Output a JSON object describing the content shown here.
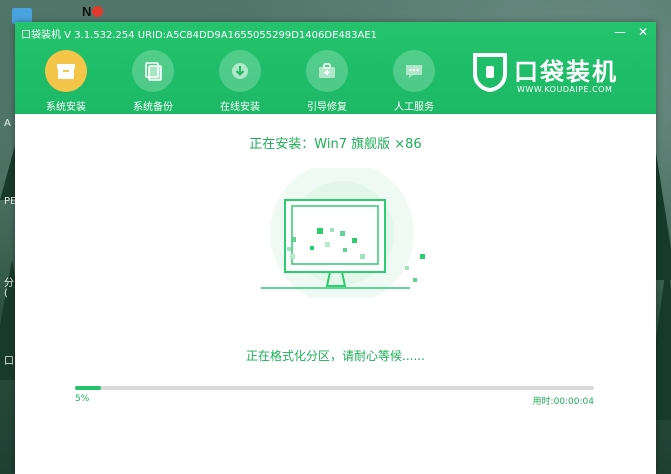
{
  "app": {
    "title": "口袋装机 V 3.1.532.254 URID:A5C84DD9A1655055299D1406DE483AE1",
    "minimize_label": "—",
    "close_label": "✕"
  },
  "desktop": {
    "badge_text": "N",
    "side_labels": [
      "A",
      "PE",
      "分",
      "(",
      "口"
    ]
  },
  "nav": {
    "items": [
      {
        "label": "系统安装",
        "icon": "package-icon",
        "active": true
      },
      {
        "label": "系统备份",
        "icon": "backup-icon",
        "active": false
      },
      {
        "label": "在线安装",
        "icon": "download-icon",
        "active": false
      },
      {
        "label": "引导修复",
        "icon": "repair-kit-icon",
        "active": false
      },
      {
        "label": "人工服务",
        "icon": "chat-icon",
        "active": false
      }
    ]
  },
  "brand": {
    "name": "口袋装机",
    "url": "WWW.KOUDAIPE.COM"
  },
  "install": {
    "status": "正在安装：Win7 旗舰版 ×86",
    "step": "正在格式化分区，请耐心等候......",
    "progress": 5,
    "progress_label": "5%",
    "elapsed": "用时:00:00:04"
  },
  "colors": {
    "accent": "#1cb866",
    "active_nav": "#f5c54a",
    "text_green": "#1fae58"
  }
}
